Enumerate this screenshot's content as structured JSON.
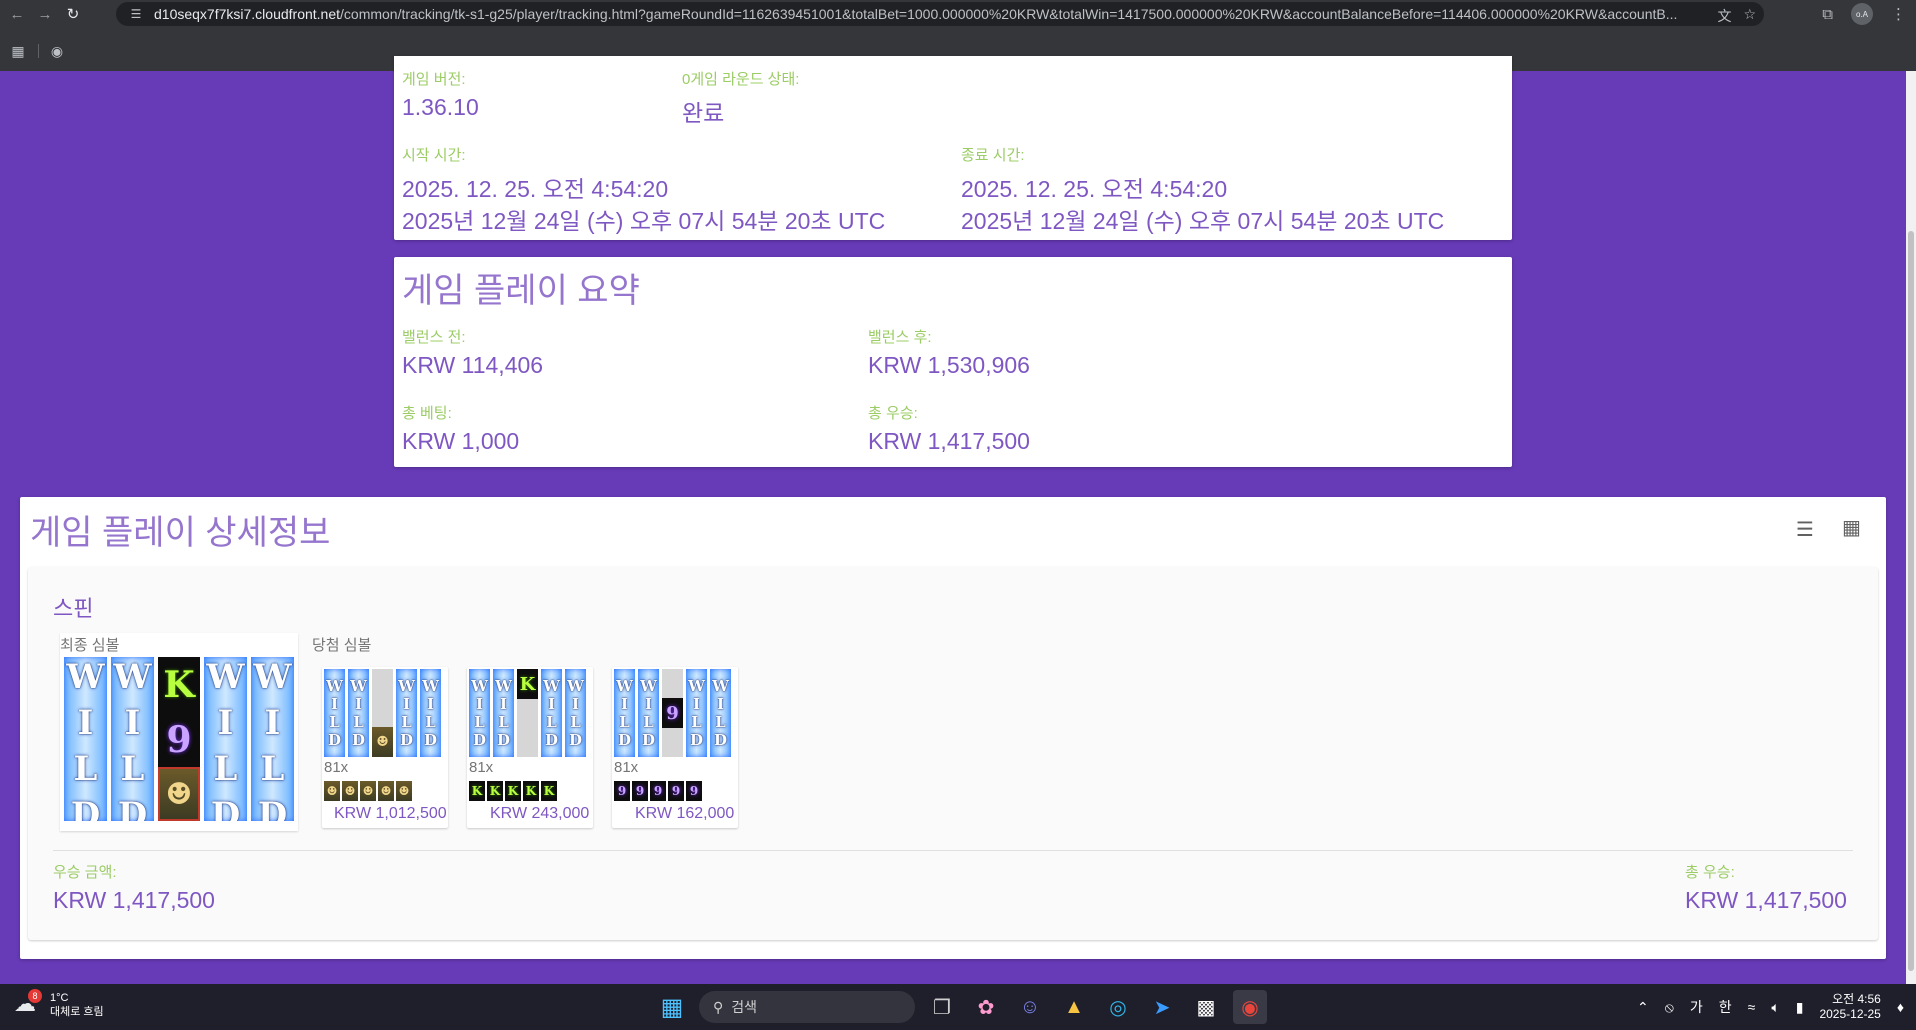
{
  "browser": {
    "url_host": "d10seqx7f7ksi7.cloudfront.net",
    "url_path": "/common/tracking/tk-s1-g25/player/tracking.html?gameRoundId=1162639451001&totalBet=1000.000000%20KRW&totalWin=1417500.000000%20KRW&accountBalanceBefore=114406.000000%20KRW&accountB..."
  },
  "round_info": {
    "game_version_label": "게임 버전:",
    "game_version": "1.36.10",
    "round_status_label": "0게임 라운드 상태:",
    "round_status": "완료",
    "start_label": "시작 시간:",
    "start_local": "2025. 12. 25. 오전 4:54:20",
    "start_utc": "2025년 12월 24일 (수) 오후 07시 54분 20초 UTC",
    "end_label": "종료 시간:",
    "end_local": "2025. 12. 25. 오전 4:54:20",
    "end_utc": "2025년 12월 24일 (수) 오후 07시 54분 20초 UTC"
  },
  "summary": {
    "title": "게임 플레이 요약",
    "balance_before_label": "밸런스 전:",
    "balance_before": "KRW 114,406",
    "balance_after_label": "밸런스 후:",
    "balance_after": "KRW 1,530,906",
    "total_bet_label": "총 베팅:",
    "total_bet": "KRW 1,000",
    "total_win_label": "총 우승:",
    "total_win": "KRW 1,417,500"
  },
  "details": {
    "title": "게임 플레이 상세정보",
    "spin_title": "스핀",
    "final_symbols_label": "최종 심볼",
    "winning_symbols_label": "당첨 심볼",
    "wild_text": "WILD",
    "wins": [
      {
        "multiplier": "81x",
        "amount": "KRW 1,012,500",
        "symbol": "man"
      },
      {
        "multiplier": "81x",
        "amount": "KRW 243,000",
        "symbol": "K"
      },
      {
        "multiplier": "81x",
        "amount": "KRW 162,000",
        "symbol": "9"
      }
    ],
    "win_amount_label": "우승 금액:",
    "win_amount": "KRW 1,417,500",
    "total_win_label": "총 우승:",
    "total_win": "KRW 1,417,500"
  },
  "taskbar": {
    "weather_temp": "1°C",
    "weather_desc": "대체로 흐림",
    "weather_badge": "8",
    "search_placeholder": "검색",
    "ime1": "가",
    "ime2": "한",
    "time": "오전 4:56",
    "date": "2025-12-25"
  }
}
